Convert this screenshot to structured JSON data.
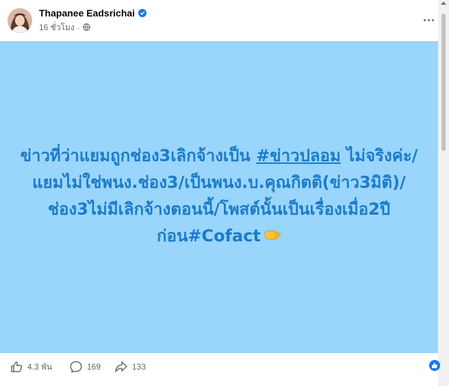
{
  "post": {
    "author": "Thapanee Eadsrichai",
    "time": "16 ชั่วโมง",
    "separator": "·",
    "text_before": "ข่าวที่ว่าแยมถูกช่อง3เลิกจ้างเป็น ",
    "hashtag": "#ข่าวปลอม",
    "text_after": " ไม่จริงค่ะ/แยมไม่ใช่พนง.ช่อง3/เป็นพนง.บ.คุณกิตติ(ข่าว3มิติ)/ช่อง3ไม่มีเลิกจ้างตอนนี้/โพสต์นั้นเป็นเรื่องเมื่อ2ปีก่อน#Cofact",
    "background_color": "#9ad5fb",
    "text_color": "#1b7bc9"
  },
  "footer": {
    "likes": "4.3 พัน",
    "comments": "169",
    "shares": "133"
  },
  "icons": {
    "verified": "verified-badge-icon",
    "privacy": "globe-icon",
    "more": "more-options-icon",
    "pointing": "backhand-index-pointing-down-icon",
    "like": "thumbs-up-icon",
    "comment": "comment-bubble-icon",
    "share": "share-arrow-icon"
  }
}
